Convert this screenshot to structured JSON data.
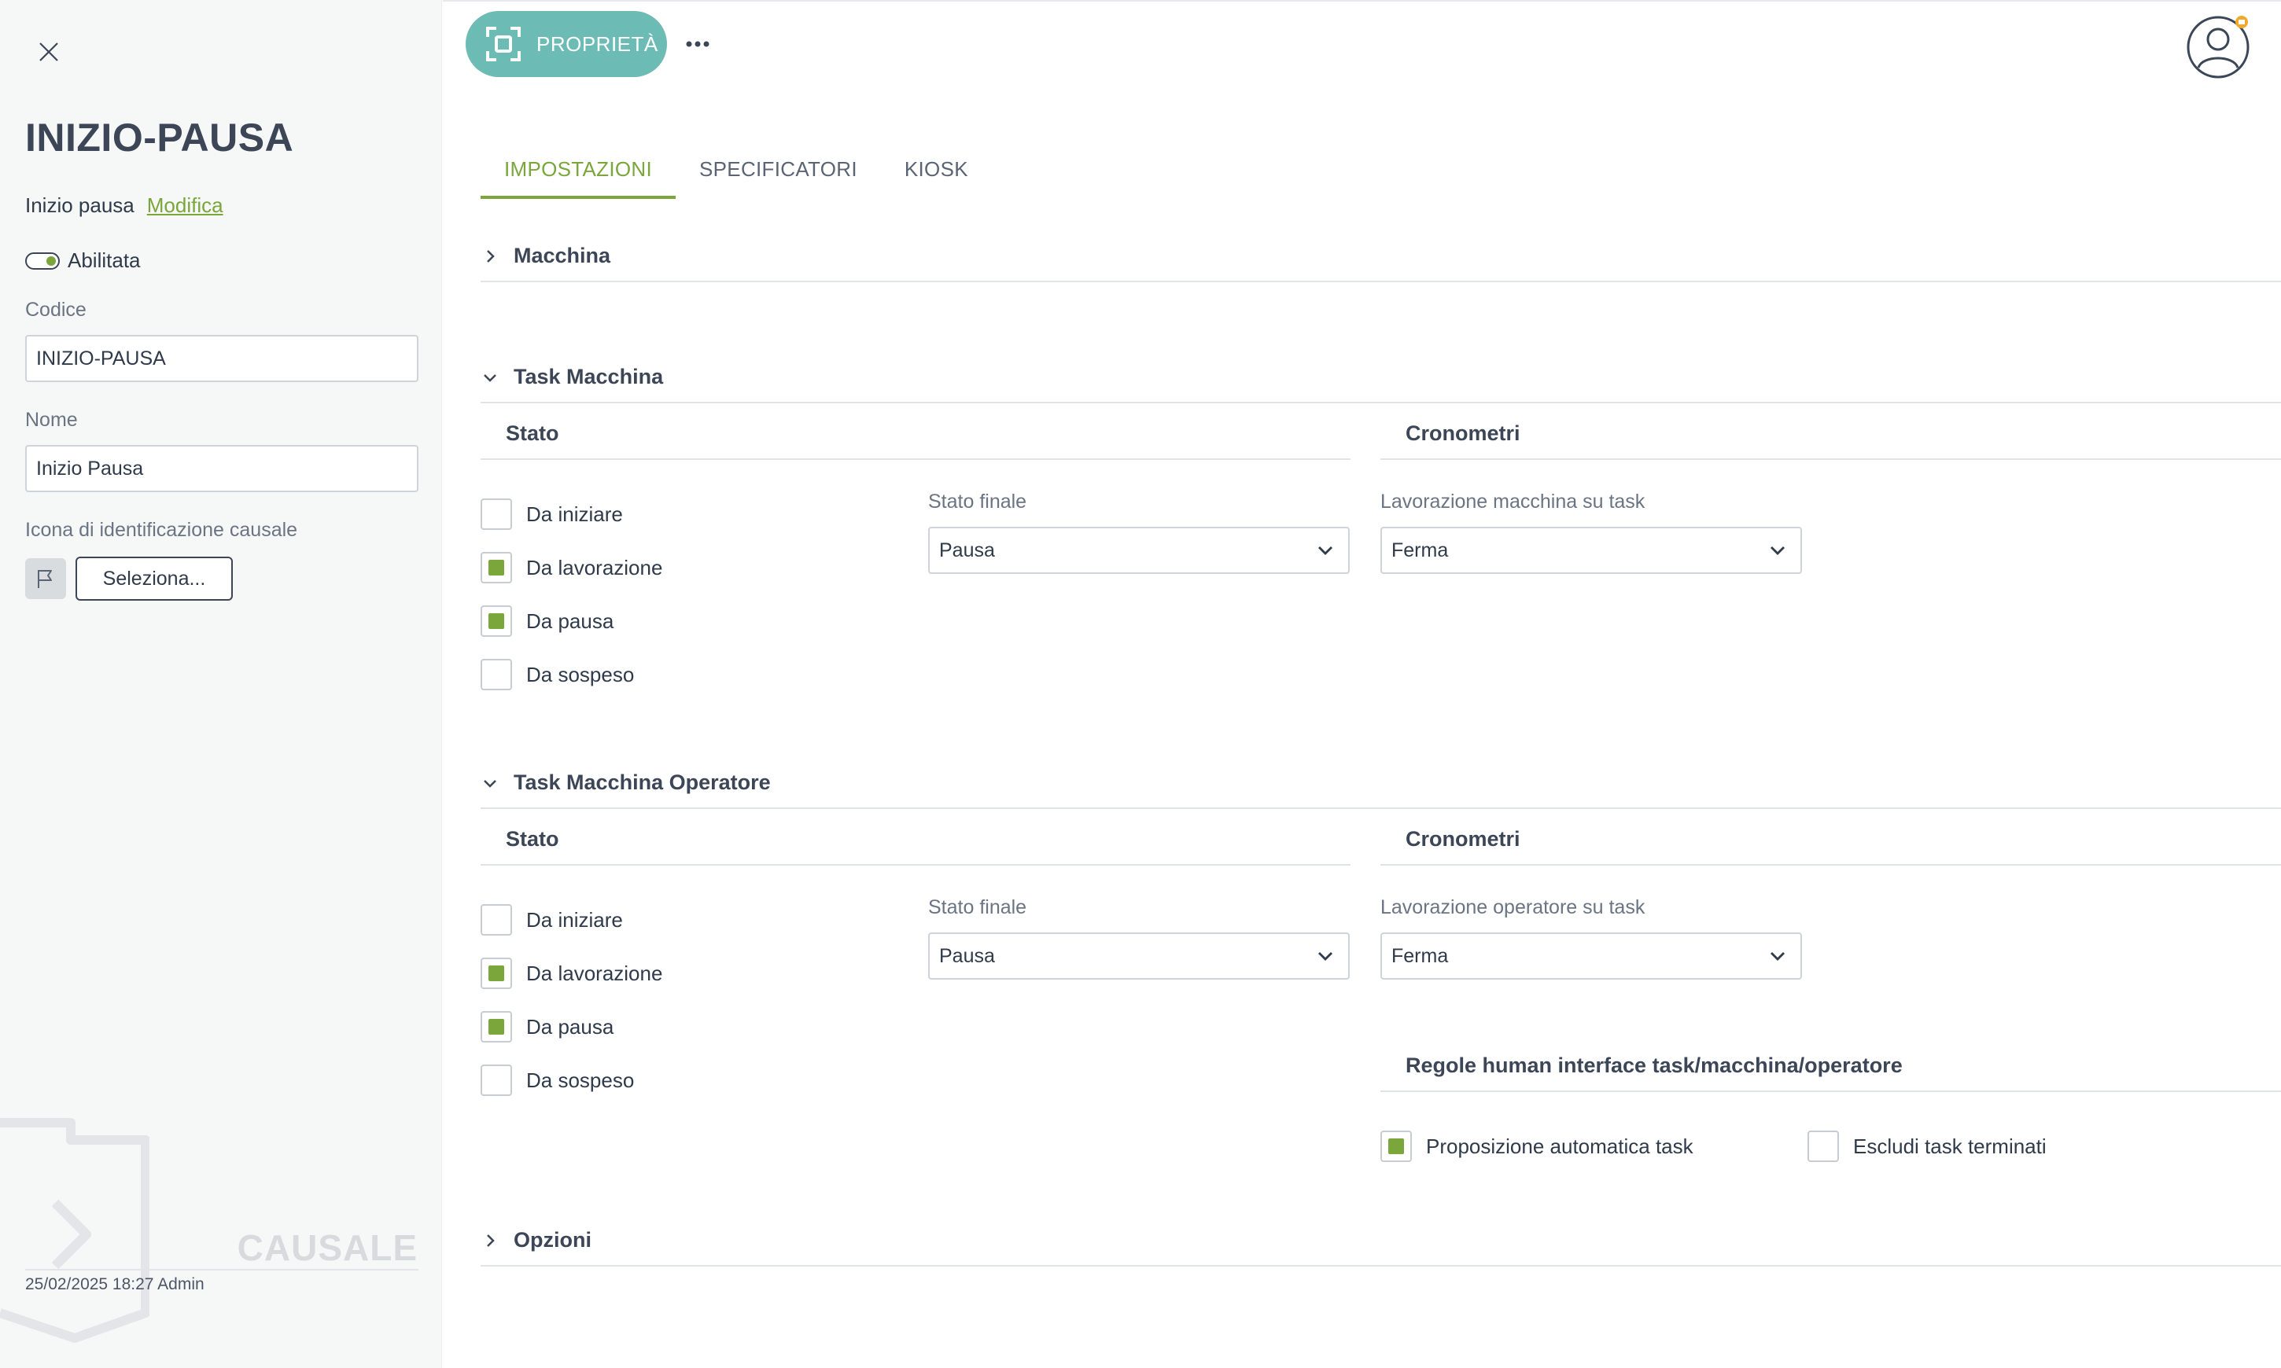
{
  "panel": {
    "title": "INIZIO-PAUSA",
    "description": "Inizio pausa",
    "edit_link": "Modifica",
    "enabled_label": "Abilitata",
    "code_label": "Codice",
    "code_value": "INIZIO-PAUSA",
    "name_label": "Nome",
    "name_value": "Inizio Pausa",
    "icon_label": "Icona di identificazione causale",
    "select_button": "Seleziona...",
    "watermark": "CAUSALE",
    "footer": "25/02/2025 18:27 Admin"
  },
  "toolbar": {
    "properties_button": "PROPRIETÀ"
  },
  "tabs": [
    "IMPOSTAZIONI",
    "SPECIFICATORI",
    "KIOSK"
  ],
  "sections": {
    "macchina": "Macchina",
    "task_macchina": {
      "title": "Task Macchina",
      "state_header": "Stato",
      "timers_header": "Cronometri",
      "checkboxes": [
        {
          "label": "Da iniziare",
          "checked": false
        },
        {
          "label": "Da lavorazione",
          "checked": true
        },
        {
          "label": "Da pausa",
          "checked": true
        },
        {
          "label": "Da sospeso",
          "checked": false
        }
      ],
      "final_state_label": "Stato finale",
      "final_state_value": "Pausa",
      "timer_label": "Lavorazione macchina su task",
      "timer_value": "Ferma"
    },
    "task_macchina_operatore": {
      "title": "Task Macchina Operatore",
      "state_header": "Stato",
      "timers_header": "Cronometri",
      "checkboxes": [
        {
          "label": "Da iniziare",
          "checked": false
        },
        {
          "label": "Da lavorazione",
          "checked": true
        },
        {
          "label": "Da pausa",
          "checked": true
        },
        {
          "label": "Da sospeso",
          "checked": false
        }
      ],
      "final_state_label": "Stato finale",
      "final_state_value": "Pausa",
      "timer_label": "Lavorazione operatore su task",
      "timer_value": "Ferma",
      "rules_header": "Regole human interface task/macchina/operatore",
      "rules": [
        {
          "label": "Proposizione automatica task",
          "checked": true
        },
        {
          "label": "Escludi task terminati",
          "checked": false
        }
      ]
    },
    "opzioni": "Opzioni"
  },
  "colors": {
    "accent": "#7aa63b",
    "teal": "#6cbbb4",
    "text": "#2f3a4a"
  }
}
